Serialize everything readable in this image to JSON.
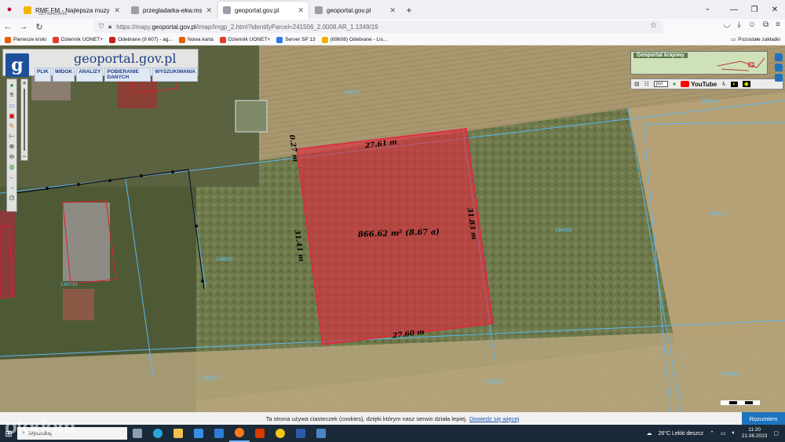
{
  "browser": {
    "tabs": [
      {
        "title": "RMF FM - Najlepsza muzyka - ...",
        "subtitle": "ODTWARZANIE",
        "color": "#f5b400",
        "active": false
      },
      {
        "title": "przegladarka-ekw.ms.gov.pl/eu...",
        "subtitle": "",
        "color": "#9aa0a6",
        "active": false
      },
      {
        "title": "geoportal.gov.pl",
        "subtitle": "",
        "color": "#9aa0a6",
        "active": true
      },
      {
        "title": "geoportal.gov.pl",
        "subtitle": "",
        "color": "#9aa0a6",
        "active": false
      }
    ],
    "url_prefix": "https://mapy.",
    "url_host": "geoportal.gov.pl",
    "url_rest": "/imap/Imgp_2.html?identifyParcel=241506_2.0008.AR_1.1349/19"
  },
  "bookmarks": [
    {
      "label": "Pierwsze kroki",
      "color": "#e66000"
    },
    {
      "label": "Dziennik UONET+",
      "color": "#e03c31"
    },
    {
      "label": "Odebrane (9 607) - ag...",
      "color": "#c5221f"
    },
    {
      "label": "Nowa karta",
      "color": "#e66000"
    },
    {
      "label": "Dziennik UONET+",
      "color": "#e03c31"
    },
    {
      "label": "Server SP 13",
      "color": "#2b78e4"
    },
    {
      "label": "(69608) Odebrane - Lis...",
      "color": "#f0b400"
    }
  ],
  "bookmarks_other": "Pozostałe zakładki",
  "geoportal": {
    "title": "geoportal.gov.pl",
    "menu": [
      "PLIK",
      "WIDOK",
      "ANALIZY",
      "POBIERANIE DANYCH",
      "WYSZUKIWANIA"
    ],
    "overview_label": "Geoportal krajowy",
    "language": "pol",
    "youtube": "YouTube"
  },
  "parcel": {
    "area": "866.62 m² (8.67 a)",
    "top_edge": "27.61 m",
    "bottom_edge": "27.60 m",
    "left_edge": "31.41 m",
    "right_edge": "31.83 m",
    "corner_edge": "0.27 m",
    "fill_color": "#e0283c"
  },
  "plot_numbers": [
    "550/10",
    "1351/10",
    "1350/10",
    "1349/19",
    "1348/10",
    "1347/10",
    "1346/10",
    "1352/10",
    "1353/10",
    "1354/10"
  ],
  "cookie": {
    "text": "Ta strona używa ciasteczek (cookies), dzięki którym nasz serwis działa lepiej.",
    "link": "Dowiedz się więcej",
    "accept": "Rozumiem"
  },
  "taskbar": {
    "search_placeholder": "Wyszukaj",
    "weather": "26°C  Lekki deszcz",
    "time": "11:20",
    "date": "21.06.2023"
  },
  "watermark": "otodom"
}
